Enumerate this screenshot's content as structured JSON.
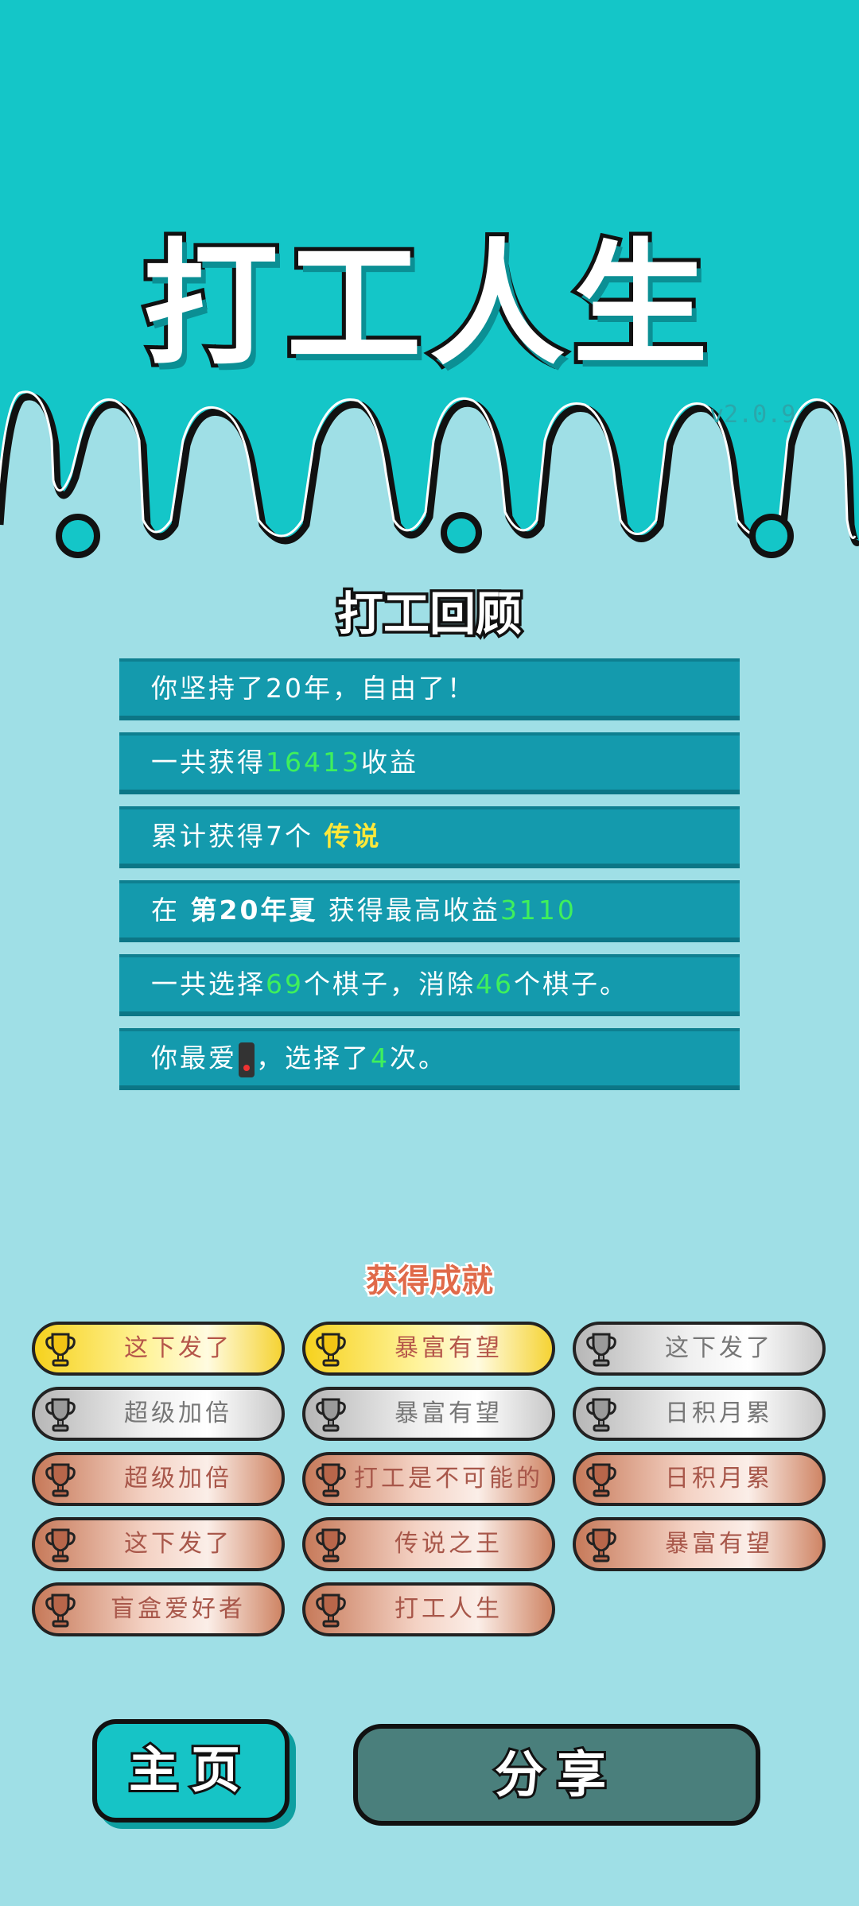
{
  "header": {
    "title": "打工人生",
    "version": "v2.0.9",
    "bg_color": "#14c6c8"
  },
  "review": {
    "title": "打工回顾",
    "rows": [
      {
        "parts": [
          "你坚持了20年，自由了！"
        ]
      },
      {
        "parts": [
          "一共获得",
          "16413",
          "收益"
        ]
      },
      {
        "parts": [
          "累计获得7个 ",
          "传说"
        ]
      },
      {
        "parts": [
          "在 ",
          "第20年夏",
          " 获得最高收益",
          "3110"
        ]
      },
      {
        "parts": [
          "一共选择",
          "69",
          "个棋子，消除",
          "46",
          "个棋子。"
        ]
      },
      {
        "parts": [
          "你最爱",
          "phone-icon",
          "，选择了",
          "4",
          "次。"
        ]
      }
    ]
  },
  "achievements": {
    "title": "获得成就",
    "badges": [
      {
        "label": "这下发了",
        "tier": "gold"
      },
      {
        "label": "暴富有望",
        "tier": "gold"
      },
      {
        "label": "这下发了",
        "tier": "silver"
      },
      {
        "label": "超级加倍",
        "tier": "silver"
      },
      {
        "label": "暴富有望",
        "tier": "silver"
      },
      {
        "label": "日积月累",
        "tier": "silver"
      },
      {
        "label": "超级加倍",
        "tier": "bronze"
      },
      {
        "label": "打工是不可能的",
        "tier": "bronze"
      },
      {
        "label": "日积月累",
        "tier": "bronze"
      },
      {
        "label": "这下发了",
        "tier": "bronze"
      },
      {
        "label": "传说之王",
        "tier": "bronze"
      },
      {
        "label": "暴富有望",
        "tier": "bronze"
      },
      {
        "label": "盲盒爱好者",
        "tier": "bronze"
      },
      {
        "label": "打工人生",
        "tier": "bronze"
      }
    ]
  },
  "buttons": {
    "home": "主页",
    "share": "分享"
  },
  "colors": {
    "accent": "#14c6c8",
    "row_bg": "#149aad",
    "highlight_green": "#3ff05c",
    "highlight_yellow": "#ffe83a"
  }
}
